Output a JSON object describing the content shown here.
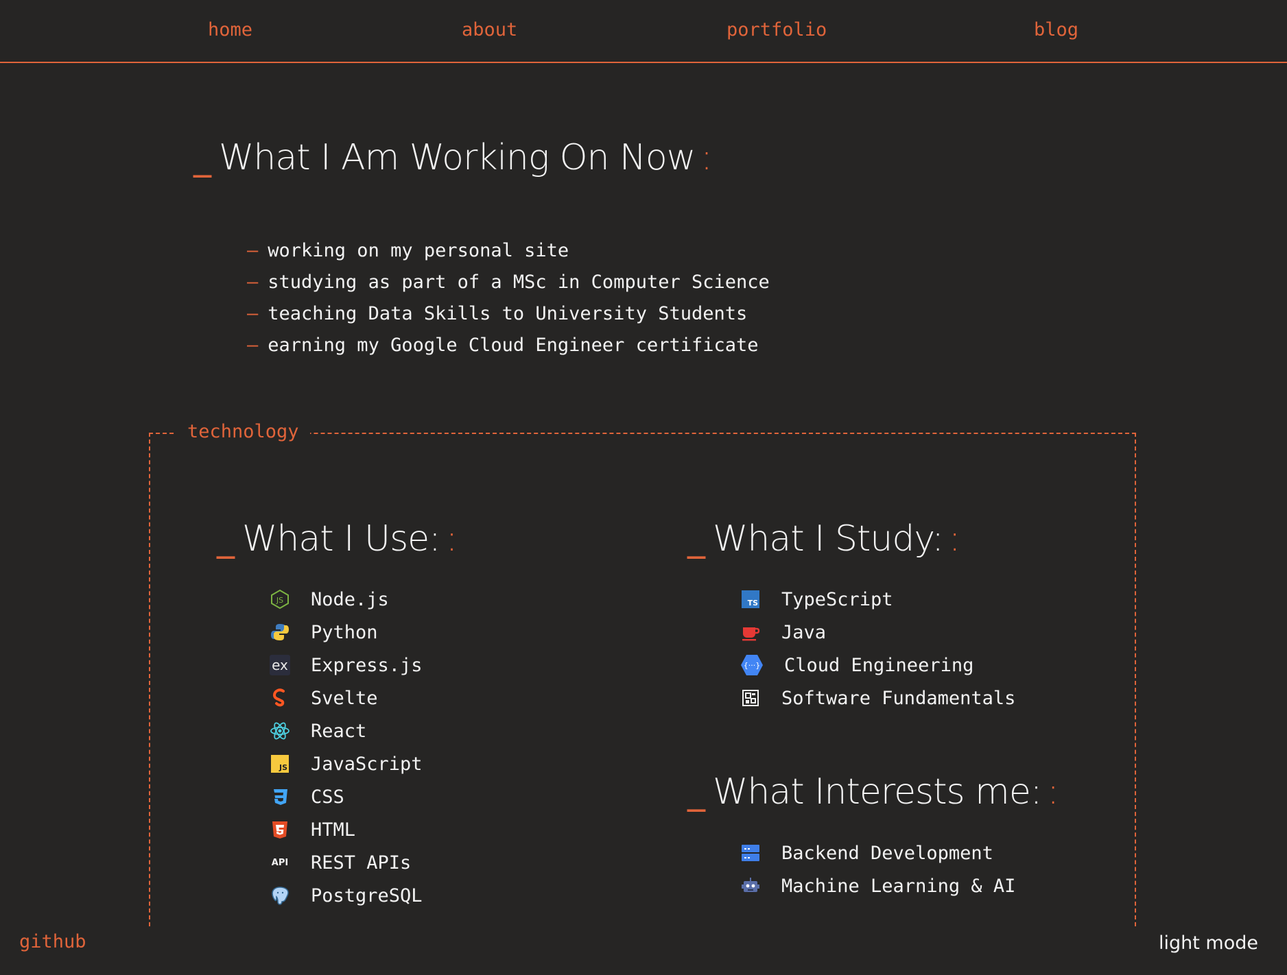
{
  "nav": {
    "home": "home",
    "about": "about",
    "portfolio": "portfolio",
    "blog": "blog"
  },
  "now": {
    "prefix": "_",
    "title": "What I Am Working On Now",
    "suffix": ":",
    "dash": "–",
    "items": [
      "working on my personal site",
      "studying as part of a MSc in Computer Science",
      "teaching Data Skills to University Students",
      "earning my Google Cloud Engineer certificate"
    ]
  },
  "technology": {
    "legend": "technology",
    "use": {
      "prefix": "_",
      "title": "What I Use:",
      "suffix": ":",
      "items": [
        {
          "label": "Node.js",
          "icon": "nodejs-icon"
        },
        {
          "label": "Python",
          "icon": "python-icon"
        },
        {
          "label": "Express.js",
          "icon": "express-icon",
          "glyph": "ex"
        },
        {
          "label": "Svelte",
          "icon": "svelte-icon"
        },
        {
          "label": "React",
          "icon": "react-icon"
        },
        {
          "label": "JavaScript",
          "icon": "javascript-icon",
          "glyph": "JS"
        },
        {
          "label": "CSS",
          "icon": "css-icon"
        },
        {
          "label": "HTML",
          "icon": "html-icon"
        },
        {
          "label": "REST APIs",
          "icon": "api-icon",
          "glyph": "API"
        },
        {
          "label": "PostgreSQL",
          "icon": "postgresql-icon"
        }
      ]
    },
    "study": {
      "prefix": "_",
      "title": "What I Study:",
      "suffix": ":",
      "items": [
        {
          "label": "TypeScript",
          "icon": "typescript-icon",
          "glyph": "TS"
        },
        {
          "label": "Java",
          "icon": "java-icon"
        },
        {
          "label": "Cloud Engineering",
          "icon": "cloud-engineering-icon",
          "glyph": "{···}"
        },
        {
          "label": "Software Fundamentals",
          "icon": "software-fundamentals-icon"
        }
      ]
    },
    "interests": {
      "prefix": "_",
      "title": "What Interests me:",
      "suffix": ":",
      "items": [
        {
          "label": "Backend Development",
          "icon": "server-icon"
        },
        {
          "label": "Machine Learning & AI",
          "icon": "robot-icon"
        }
      ]
    }
  },
  "footer": {
    "github": "github",
    "mode": "light mode"
  },
  "colors": {
    "background": "#262524",
    "accent": "#e0643a",
    "text": "#f2f2f2"
  }
}
